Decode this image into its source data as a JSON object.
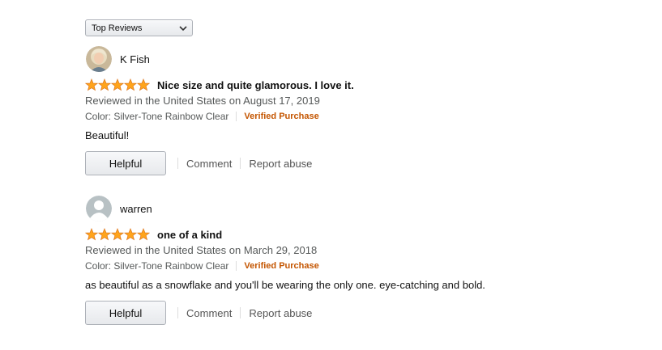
{
  "sort": {
    "selected": "Top Reviews"
  },
  "reviews": [
    {
      "name": "K Fish",
      "avatar": "profile-photo",
      "rating": 5,
      "title": "Nice size and quite glamorous. I love it.",
      "reviewed": "Reviewed in the United States on August 17, 2019",
      "format": "Color: Silver-Tone Rainbow Clear",
      "verified": "Verified Purchase",
      "body": "Beautiful!",
      "helpful": "Helpful",
      "comment": "Comment",
      "report": "Report abuse"
    },
    {
      "name": "warren",
      "avatar": "default-avatar",
      "rating": 5,
      "title": "one of a kind",
      "reviewed": "Reviewed in the United States on March 29, 2018",
      "format": "Color: Silver-Tone Rainbow Clear",
      "verified": "Verified Purchase",
      "body": "as beautiful as a snowflake and you'll be wearing the only one. eye-catching and bold.",
      "helpful": "Helpful",
      "comment": "Comment",
      "report": "Report abuse"
    }
  ],
  "colors": {
    "star": "#ffa41c",
    "verified": "#c45500",
    "meta": "#565959"
  }
}
